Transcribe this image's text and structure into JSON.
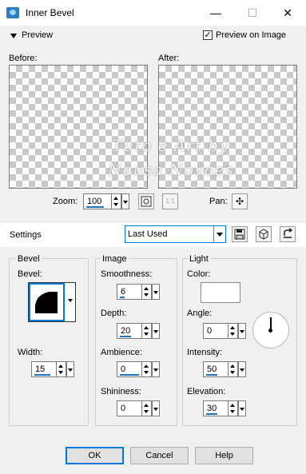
{
  "window": {
    "title": "Inner Bevel",
    "minimize": "—",
    "maximize": "☐",
    "close": "✕"
  },
  "preview": {
    "toggle_label": "Preview",
    "preview_on_image_label": "Preview on Image",
    "preview_on_image_checked": true,
    "check_mark": "✓"
  },
  "panes": {
    "before_label": "Before:",
    "after_label": "After:"
  },
  "zoom": {
    "label": "Zoom:",
    "value": "100",
    "pan_label": "Pan:",
    "pan_icon": "✣",
    "actual_size_label": "1:1"
  },
  "settings": {
    "label": "Settings",
    "preset": "Last Used"
  },
  "bevel": {
    "group_title": "Bevel",
    "bevel_label": "Bevel:",
    "width_label": "Width:",
    "width_value": "15"
  },
  "image": {
    "group_title": "Image",
    "smoothness_label": "Smoothness:",
    "smoothness_value": "6",
    "depth_label": "Depth:",
    "depth_value": "20",
    "ambience_label": "Ambience:",
    "ambience_value": "0",
    "shininess_label": "Shininess:",
    "shininess_value": "0"
  },
  "light": {
    "group_title": "Light",
    "color_label": "Color:",
    "color_value": "#ffffff",
    "angle_label": "Angle:",
    "angle_value": "0",
    "intensity_label": "Intensity:",
    "intensity_value": "50",
    "elevation_label": "Elevation:",
    "elevation_value": "30"
  },
  "buttons": {
    "ok": "OK",
    "cancel": "Cancel",
    "help": "Help"
  },
  "watermark": {
    "line1": "Tuto e Art by",
    "line2": "Neusa Novaes"
  },
  "colors": {
    "accent": "#0078d7",
    "titlebar": "#ffffff",
    "dialog_bg": "#f0f0f0"
  }
}
